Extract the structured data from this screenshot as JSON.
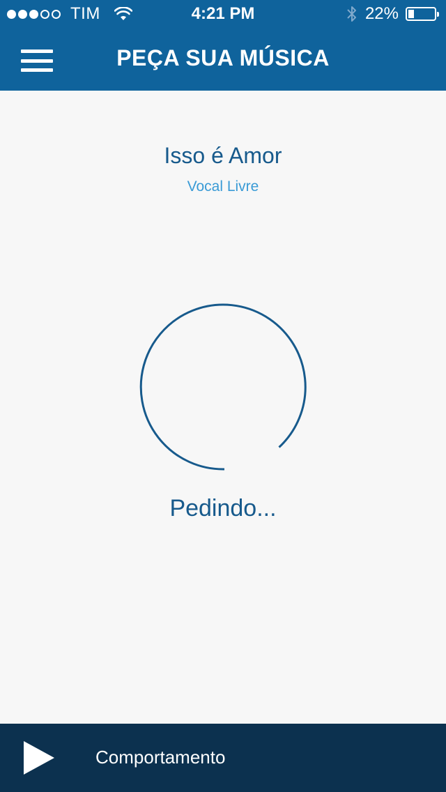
{
  "status_bar": {
    "carrier": "TIM",
    "time": "4:21 PM",
    "battery_percent": "22%",
    "battery_level": 0.22,
    "signal_bars_filled": 3,
    "signal_bars_total": 5
  },
  "header": {
    "title": "PEÇA SUA MÚSICA",
    "menu_icon": "hamburger-menu-icon"
  },
  "song": {
    "title": "Isso é Amor",
    "artist": "Vocal Livre"
  },
  "request": {
    "status": "Pedindo...",
    "indicator": "loading-spinner"
  },
  "player": {
    "track": "Comportamento",
    "play_icon": "play-icon"
  },
  "colors": {
    "header_bg": "#0f639c",
    "accent": "#175a8c",
    "artist": "#3a9bd6",
    "player_bg": "#0c314f",
    "background": "#f7f7f7"
  }
}
